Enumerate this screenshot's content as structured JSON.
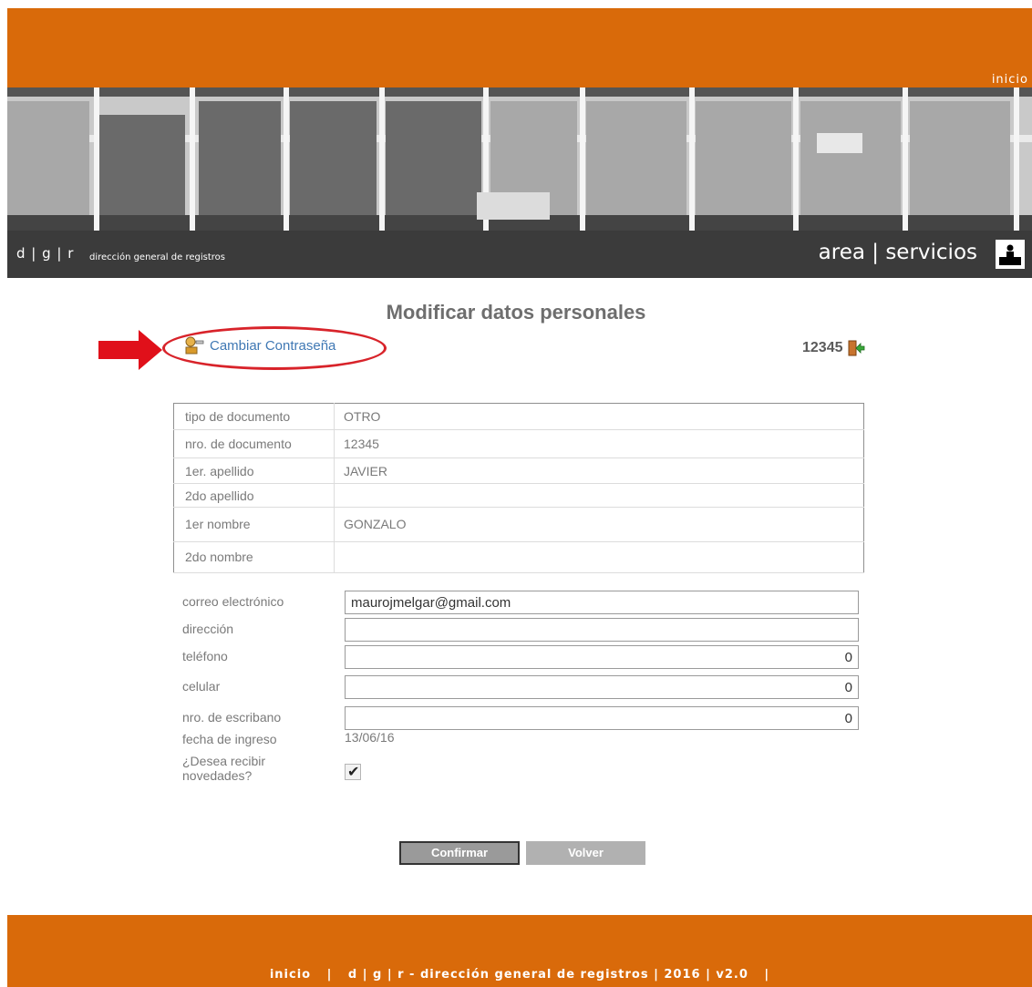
{
  "header": {
    "inicio_link": "inicio",
    "brand": "d | g | r",
    "brand_sub": "dirección general de registros",
    "area_title": "area | servicios"
  },
  "page": {
    "title": "Modificar datos personales",
    "change_password_link": "Cambiar Contraseña",
    "user_id": "12345"
  },
  "document_table": [
    {
      "label": "tipo de documento",
      "value": "OTRO"
    },
    {
      "label": "nro. de documento",
      "value": "12345"
    },
    {
      "label": "1er. apellido",
      "value": "JAVIER"
    },
    {
      "label": "2do apellido",
      "value": ""
    },
    {
      "label": "1er nombre",
      "value": "GONZALO"
    },
    {
      "label": "2do nombre",
      "value": ""
    }
  ],
  "form": {
    "email_label": "correo electrónico",
    "email_value": "maurojmelgar@gmail.com",
    "address_label": "dirección",
    "address_value": "",
    "phone_label": "teléfono",
    "phone_value": "0",
    "mobile_label": "celular",
    "mobile_value": "0",
    "notary_label": "nro. de escribano",
    "notary_value": "0",
    "entry_date_label": "fecha de ingreso",
    "entry_date_value": "13/06/16",
    "newsletter_label": "¿Desea recibir novedades?",
    "newsletter_checked": true
  },
  "buttons": {
    "confirm": "Confirmar",
    "back": "Volver"
  },
  "footer": {
    "inicio": "inicio",
    "separator": "|",
    "text": "d | g | r - dirección general de registros | 2016 | v2.0",
    "trailing_separator": "|"
  },
  "colors": {
    "orange": "#d96a0a",
    "dark_bar": "#3b3b3b",
    "link_blue": "#3f78b4",
    "annotation_red": "#d8232a"
  }
}
